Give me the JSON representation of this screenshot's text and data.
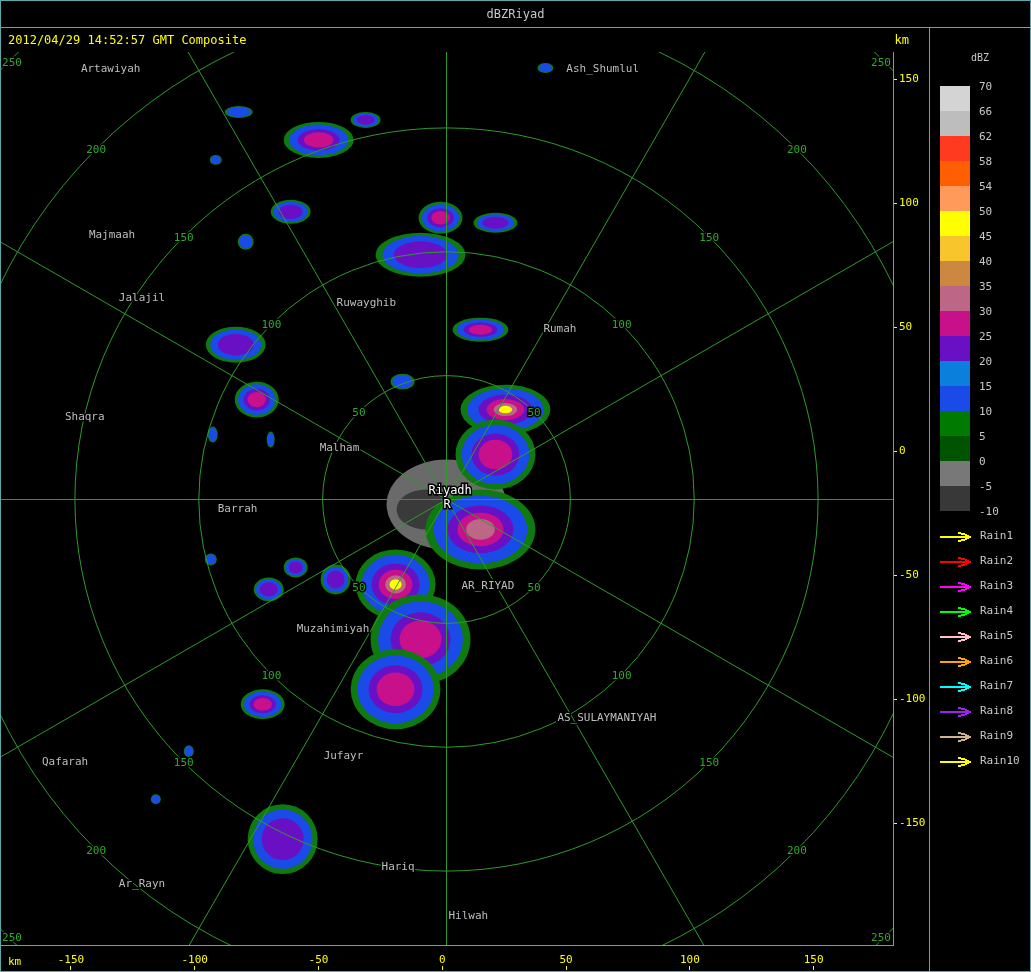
{
  "window": {
    "title": "dBZRiyad"
  },
  "header": {
    "timestamp": "2012/04/29 14:52:57 GMT Composite",
    "unit": "km"
  },
  "map": {
    "range_rings": [
      {
        "labels": [
          "50",
          "50",
          "50",
          "50"
        ]
      },
      {
        "labels": [
          "100",
          "100",
          "100",
          "100"
        ]
      },
      {
        "labels": [
          "150",
          "150",
          "150",
          "150"
        ]
      },
      {
        "labels": [
          "200",
          "200",
          "200",
          "200"
        ]
      },
      {
        "labels": [
          "250",
          "250",
          "250",
          "250"
        ]
      }
    ],
    "towns": [
      {
        "name": "Artawiyah",
        "kind": "town"
      },
      {
        "name": "Ash_Shumlul",
        "kind": "town"
      },
      {
        "name": "Majmaah",
        "kind": "town"
      },
      {
        "name": "Jalajil",
        "kind": "town"
      },
      {
        "name": "Ruwayghib",
        "kind": "town"
      },
      {
        "name": "Rumah",
        "kind": "town"
      },
      {
        "name": "Shaqra",
        "kind": "town"
      },
      {
        "name": "Malham",
        "kind": "town"
      },
      {
        "name": "Riyadh",
        "kind": "site"
      },
      {
        "name": "R",
        "kind": "site"
      },
      {
        "name": "Barrah",
        "kind": "town"
      },
      {
        "name": "AR_RIYAD",
        "kind": "town"
      },
      {
        "name": "Muzahimiyah",
        "kind": "town"
      },
      {
        "name": "AS_SULAYMANIYAH",
        "kind": "town"
      },
      {
        "name": "Qafarah",
        "kind": "town"
      },
      {
        "name": "Jufayr",
        "kind": "town"
      },
      {
        "name": "Hariq",
        "kind": "town"
      },
      {
        "name": "Ar_Rayn",
        "kind": "town"
      },
      {
        "name": "Hilwah",
        "kind": "town"
      }
    ]
  },
  "y_axis": {
    "ticks": [
      "150",
      "100",
      "50",
      "0",
      "-50",
      "-100",
      "-150"
    ]
  },
  "x_axis": {
    "unit": "km",
    "ticks": [
      "-150",
      "-100",
      "-50",
      "0",
      "50",
      "100",
      "150"
    ]
  },
  "legend": {
    "title": "dBZ",
    "labels": [
      "70",
      "66",
      "62",
      "58",
      "54",
      "50",
      "45",
      "40",
      "35",
      "30",
      "25",
      "20",
      "15",
      "10",
      "5",
      "0",
      "-5",
      "-10"
    ],
    "bins": [
      {
        "color": "#d4d4d4"
      },
      {
        "color": "#bdbdbd"
      },
      {
        "color": "#ff3a1f"
      },
      {
        "color": "#ff5f00"
      },
      {
        "color": "#ff9a5a"
      },
      {
        "color": "#ffff00"
      },
      {
        "color": "#f9c52c"
      },
      {
        "color": "#cc8840"
      },
      {
        "color": "#bc6786"
      },
      {
        "color": "#c8108a"
      },
      {
        "color": "#6a10c4"
      },
      {
        "color": "#0a80dc"
      },
      {
        "color": "#1a4ae8"
      },
      {
        "color": "#007a00"
      },
      {
        "color": "#005400"
      },
      {
        "color": "#787878"
      },
      {
        "color": "#383838"
      }
    ]
  },
  "tracks": [
    {
      "label": "Rain1",
      "color": "#ffff00"
    },
    {
      "label": "Rain2",
      "color": "#ff0000"
    },
    {
      "label": "Rain3",
      "color": "#ff00ff"
    },
    {
      "label": "Rain4",
      "color": "#00ff00"
    },
    {
      "label": "Rain5",
      "color": "#ffc0cb"
    },
    {
      "label": "Rain6",
      "color": "#ffa500"
    },
    {
      "label": "Rain7",
      "color": "#00ffff"
    },
    {
      "label": "Rain8",
      "color": "#a020f0"
    },
    {
      "label": "Rain9",
      "color": "#d2b48c"
    },
    {
      "label": "Rain10",
      "color": "#ffff00"
    }
  ]
}
